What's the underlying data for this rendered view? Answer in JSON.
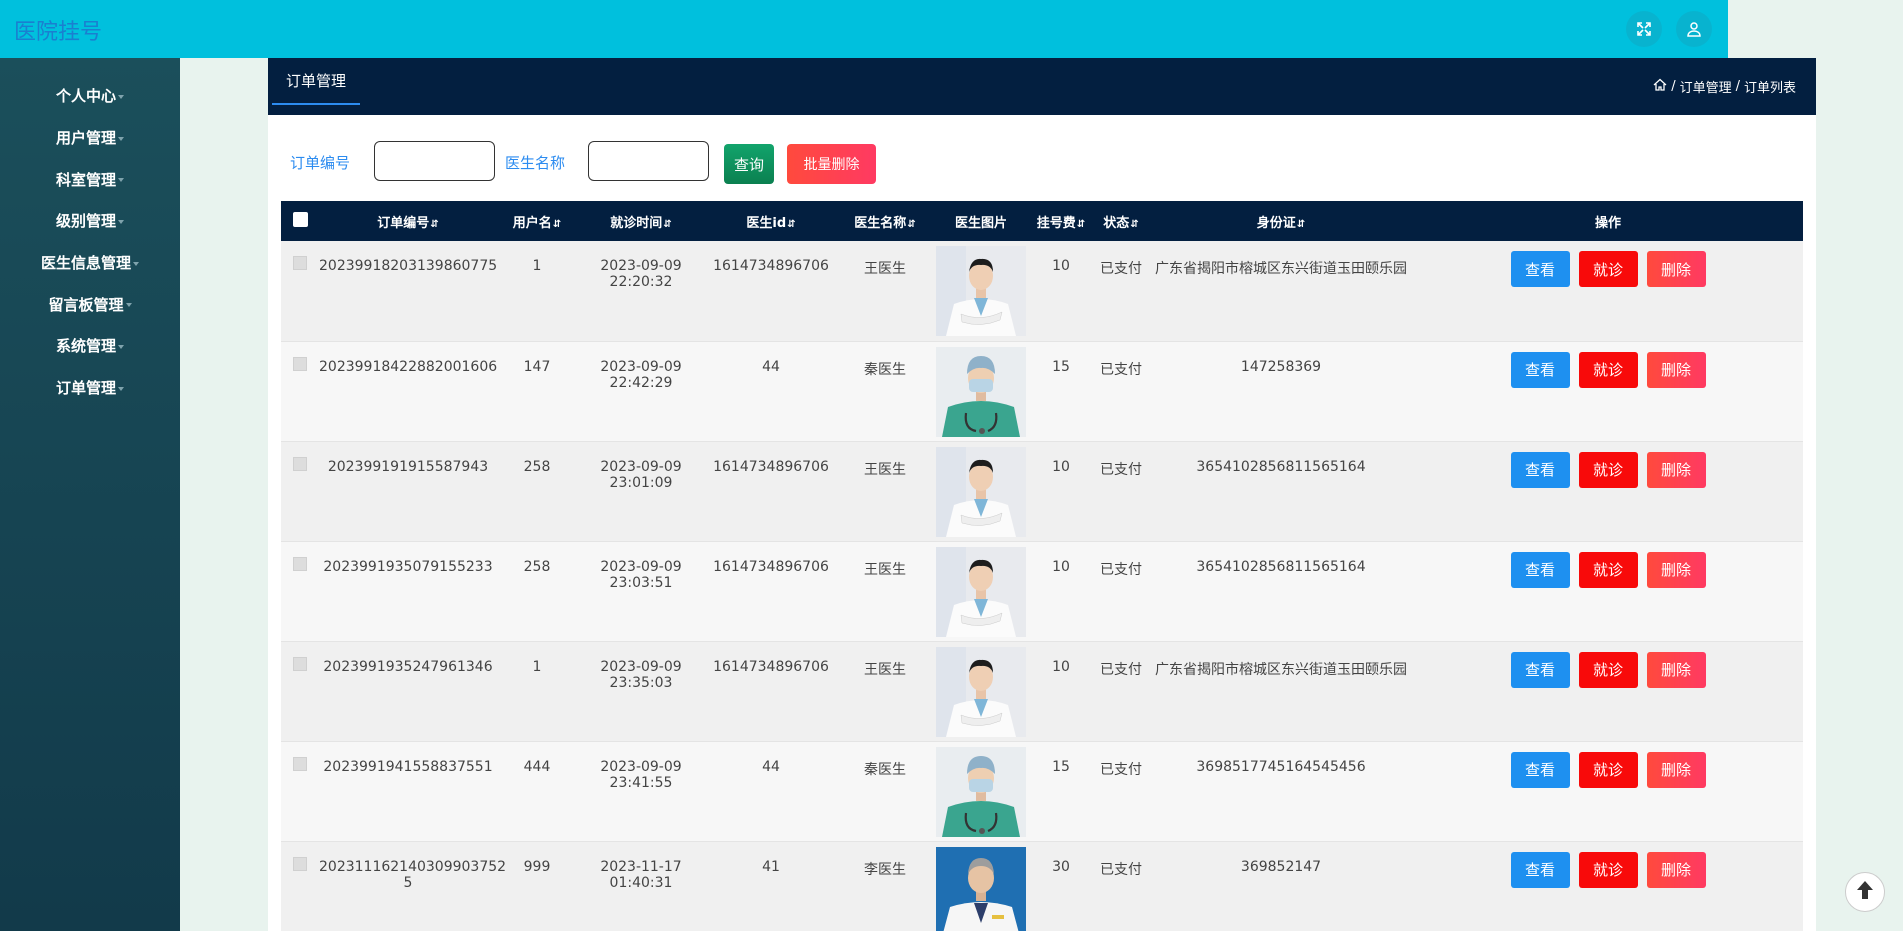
{
  "app": {
    "title": "医院挂号"
  },
  "topbar": {
    "icons": [
      "fullscreen-icon",
      "user-icon"
    ]
  },
  "sidebar": {
    "items": [
      {
        "label": "个人中心"
      },
      {
        "label": "用户管理"
      },
      {
        "label": "科室管理"
      },
      {
        "label": "级别管理"
      },
      {
        "label": "医生信息管理"
      },
      {
        "label": "留言板管理"
      },
      {
        "label": "系统管理"
      },
      {
        "label": "订单管理"
      }
    ]
  },
  "header": {
    "tab": "订单管理",
    "breadcrumb": {
      "sep": "/",
      "level1": "订单管理",
      "level2": "订单列表"
    }
  },
  "search": {
    "order_label": "订单编号",
    "order_value": "",
    "doctor_label": "医生名称",
    "doctor_value": "",
    "query_label": "查询",
    "bulk_delete_label": "批量删除"
  },
  "table": {
    "columns": [
      "订单编号",
      "用户名",
      "就诊时间",
      "医生id",
      "医生名称",
      "医生图片",
      "挂号费",
      "状态",
      "身份证",
      "操作"
    ],
    "action_labels": {
      "view": "查看",
      "visit": "就诊",
      "delete": "删除"
    },
    "rows": [
      {
        "order_no": "20239918203139860775",
        "username": "1",
        "visit_time": "2023-09-09 22:20:32",
        "doctor_id": "1614734896706",
        "doctor_name": "王医生",
        "photo": "doctor-a",
        "fee": "10",
        "status": "已支付",
        "id_card": "广东省揭阳市榕城区东兴街道玉田颐乐园"
      },
      {
        "order_no": "20239918422882001606",
        "username": "147",
        "visit_time": "2023-09-09 22:42:29",
        "doctor_id": "44",
        "doctor_name": "秦医生",
        "photo": "doctor-b",
        "fee": "15",
        "status": "已支付",
        "id_card": "147258369"
      },
      {
        "order_no": "202399191915587943",
        "username": "258",
        "visit_time": "2023-09-09 23:01:09",
        "doctor_id": "1614734896706",
        "doctor_name": "王医生",
        "photo": "doctor-a",
        "fee": "10",
        "status": "已支付",
        "id_card": "3654102856811565164"
      },
      {
        "order_no": "2023991935079155233",
        "username": "258",
        "visit_time": "2023-09-09 23:03:51",
        "doctor_id": "1614734896706",
        "doctor_name": "王医生",
        "photo": "doctor-a",
        "fee": "10",
        "status": "已支付",
        "id_card": "3654102856811565164"
      },
      {
        "order_no": "2023991935247961346",
        "username": "1",
        "visit_time": "2023-09-09 23:35:03",
        "doctor_id": "1614734896706",
        "doctor_name": "王医生",
        "photo": "doctor-a",
        "fee": "10",
        "status": "已支付",
        "id_card": "广东省揭阳市榕城区东兴街道玉田颐乐园"
      },
      {
        "order_no": "2023991941558837551",
        "username": "444",
        "visit_time": "2023-09-09 23:41:55",
        "doctor_id": "44",
        "doctor_name": "秦医生",
        "photo": "doctor-b",
        "fee": "15",
        "status": "已支付",
        "id_card": "3698517745164545456"
      },
      {
        "order_no": "202311162140309903752​5",
        "username": "999",
        "visit_time": "2023-11-17 01:40:31",
        "doctor_id": "41",
        "doctor_name": "李医生",
        "photo": "doctor-c",
        "fee": "30",
        "status": "已支付",
        "id_card": "369852147"
      }
    ]
  },
  "colors": {
    "topbar": "#00c0dd",
    "sidebar": "#123a4a",
    "header": "#031f40",
    "view": "#1e90f0",
    "visit": "#f80a0a",
    "delete": "#ff3a62",
    "query": "#0b8050"
  }
}
